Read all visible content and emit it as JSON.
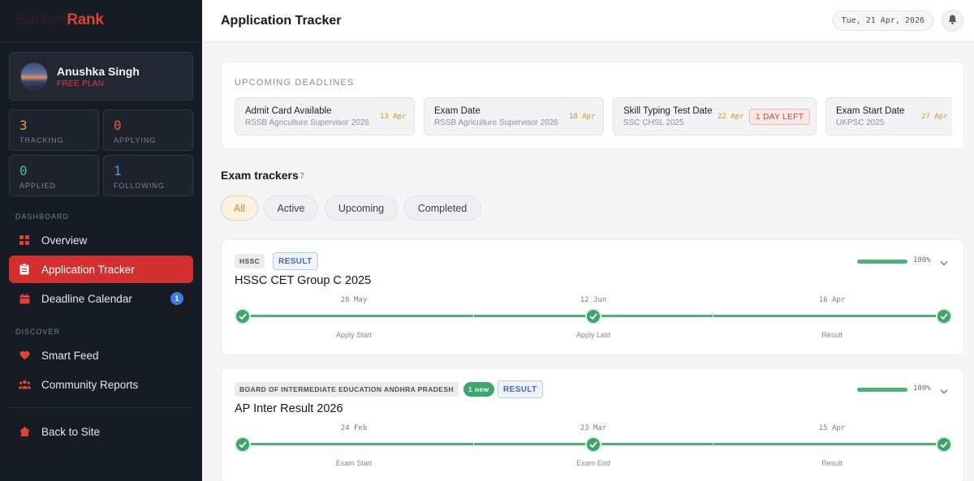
{
  "brand": {
    "prefix": "Sarkari",
    "name": "Rank"
  },
  "profile": {
    "name": "Anushka Singh",
    "plan": "FREE PLAN"
  },
  "stats": [
    {
      "value": "3",
      "label": "TRACKING",
      "color": "#e8a13a"
    },
    {
      "value": "0",
      "label": "APPLYING",
      "color": "#e0584f"
    },
    {
      "value": "0",
      "label": "APPLIED",
      "color": "#4fc08a"
    },
    {
      "value": "1",
      "label": "FOLLOWING",
      "color": "#5b8ef0"
    }
  ],
  "sidebar": {
    "dashboard_label": "DASHBOARD",
    "discover_label": "DISCOVER",
    "items": [
      {
        "label": "Overview",
        "icon": "grid-icon"
      },
      {
        "label": "Application Tracker",
        "icon": "clipboard-icon",
        "active": true
      },
      {
        "label": "Deadline Calendar",
        "icon": "calendar-icon",
        "badge": "1"
      },
      {
        "label": "Smart Feed",
        "icon": "heart-icon"
      },
      {
        "label": "Community Reports",
        "icon": "users-icon"
      },
      {
        "label": "Back to Site",
        "icon": "home-icon"
      }
    ]
  },
  "header": {
    "title": "Application Tracker",
    "date": "Tue, 21 Apr, 2026"
  },
  "deadlines": {
    "title": "UPCOMING DEADLINES",
    "items": [
      {
        "title": "Admit Card Available",
        "sub": "RSSB Agriculture Supervisor 2026",
        "date": "13 Apr"
      },
      {
        "title": "Exam Date",
        "sub": "RSSB Agriculture Supervisor 2026",
        "date": "18 Apr"
      },
      {
        "title": "Skill Typing Test Date",
        "sub": "SSC CHSL 2025",
        "date": "22 Apr",
        "tag": "1 DAY LEFT"
      },
      {
        "title": "Exam Start Date",
        "sub": "UKPSC 2025",
        "date": "27 Apr"
      }
    ]
  },
  "trackers": {
    "title": "Exam trackers",
    "count": "7",
    "filters": [
      "All",
      "Active",
      "Upcoming",
      "Completed"
    ],
    "exams": [
      {
        "org": "HSSC",
        "new": "",
        "status": "RESULT",
        "title": "HSSC CET Group C 2025",
        "progress": "100%",
        "progress_value": 100,
        "steps": [
          {
            "date": "28 May",
            "label": "Apply Start"
          },
          {
            "date": "12 Jun",
            "label": "Apply Last"
          },
          {
            "date": "16 Apr",
            "label": "Result"
          }
        ]
      },
      {
        "org": "BOARD OF INTERMEDIATE EDUCATION ANDHRA PRADESH",
        "new": "1 new",
        "status": "RESULT",
        "title": "AP Inter Result 2026",
        "progress": "100%",
        "progress_value": 100,
        "steps": [
          {
            "date": "24 Feb",
            "label": "Exam Start"
          },
          {
            "date": "23 Mar",
            "label": "Exam End"
          },
          {
            "date": "15 Apr",
            "label": "Result"
          }
        ]
      }
    ]
  },
  "colors": {
    "accent": "#d42f2f",
    "success": "#3fa36a",
    "warning": "#d4902a",
    "info": "#4468c2"
  }
}
